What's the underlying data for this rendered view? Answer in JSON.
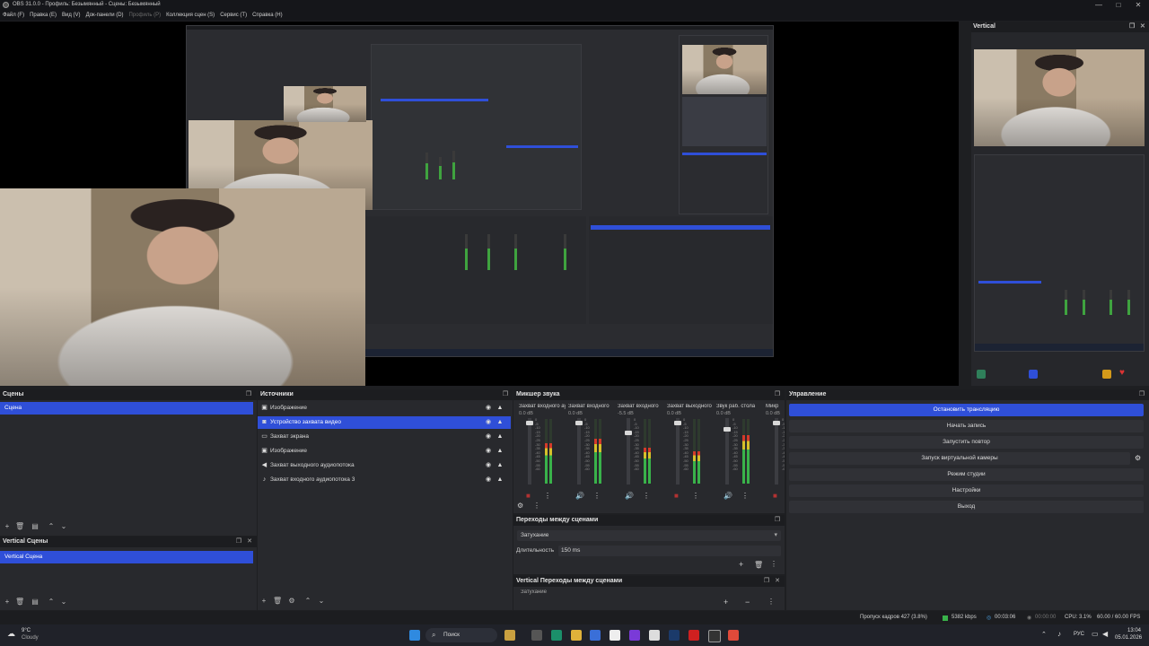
{
  "window": {
    "title": "OBS 31.0.0 - Профиль: Безымянный - Сцены: Безымянный",
    "controls": [
      "—",
      "□",
      "✕"
    ]
  },
  "menu": [
    {
      "label": "Файл (F)",
      "enabled": true
    },
    {
      "label": "Правка (E)",
      "enabled": true
    },
    {
      "label": "Вид (V)",
      "enabled": true
    },
    {
      "label": "Док-панели (D)",
      "enabled": true
    },
    {
      "label": "Профиль (P)",
      "enabled": false
    },
    {
      "label": "Коллекция сцен (S)",
      "enabled": true
    },
    {
      "label": "Сервис (T)",
      "enabled": true
    },
    {
      "label": "Справка (H)",
      "enabled": true
    }
  ],
  "vertical_preview": {
    "title": "Vertical"
  },
  "scenes": {
    "title": "Сцены",
    "items": [
      {
        "label": "Сцена",
        "selected": true
      }
    ]
  },
  "vertical_scenes": {
    "title": "Vertical Сцены",
    "items": [
      {
        "label": "Vertical Сцена",
        "selected": true
      }
    ]
  },
  "sources": {
    "title": "Источники",
    "items": [
      {
        "label": "Изображение",
        "icon": "image-icon",
        "selected": false
      },
      {
        "label": "Устройство захвата видео",
        "icon": "camera-icon",
        "selected": true
      },
      {
        "label": "Захват экрана",
        "icon": "monitor-icon",
        "selected": false
      },
      {
        "label": "Изображение",
        "icon": "image-icon",
        "selected": false
      },
      {
        "label": "Захват выходного аудиопотока",
        "icon": "speaker-icon",
        "selected": false
      },
      {
        "label": "Захват входного аудиопотока 3",
        "icon": "microphone-icon",
        "selected": false
      }
    ]
  },
  "mixer": {
    "title": "Микшер звука",
    "scale": [
      "0",
      "-5",
      "-10",
      "-15",
      "-20",
      "-25",
      "-30",
      "-35",
      "-40",
      "-45",
      "-50",
      "-55",
      "-60"
    ],
    "channels": [
      {
        "name": "Захват входного ауди",
        "db": "0.0 dB",
        "level": 0.62,
        "fader": 0.05,
        "muted": true
      },
      {
        "name": "Захват входного",
        "db": "0.0 dB",
        "level": 0.7,
        "fader": 0.05,
        "muted": false
      },
      {
        "name": "Захват входного",
        "db": "-5.5 dB",
        "level": 0.55,
        "fader": 0.2,
        "muted": false
      },
      {
        "name": "Захват выходного",
        "db": "0.0 dB",
        "level": 0.5,
        "fader": 0.05,
        "muted": true
      },
      {
        "name": "Звук раб. стола",
        "db": "0.0 dB",
        "level": 0.75,
        "fader": 0.15,
        "muted": false
      },
      {
        "name": "Микр",
        "db": "0.0 dB",
        "level": 0.0,
        "fader": 0.05,
        "muted": true
      }
    ]
  },
  "transitions": {
    "title": "Переходы между сценами",
    "selected": "Затухание",
    "duration_label": "Длительность",
    "duration_value": "150 ms"
  },
  "vertical_transitions": {
    "title": "Vertical Переходы между сценами",
    "selected": "Затухание"
  },
  "controls": {
    "title": "Управление",
    "buttons": [
      {
        "label": "Остановить трансляцию",
        "active": true
      },
      {
        "label": "Начать запись",
        "active": false
      },
      {
        "label": "Запустить повтор",
        "active": false
      },
      {
        "label": "Запуск виртуальной камеры",
        "active": false
      },
      {
        "label": "Режим студии",
        "active": false
      },
      {
        "label": "Настройки",
        "active": false
      },
      {
        "label": "Выход",
        "active": false
      }
    ]
  },
  "status": {
    "dropped": "Пропуск кадров 427 (3.8%)",
    "bitrate": "5382 kbps",
    "stream_time": "00:03:06",
    "rec_time": "00:00:00",
    "cpu": "CPU: 3.1%",
    "fps": "60.00 / 60.00 FPS"
  },
  "taskbar": {
    "weather_temp": "9°C",
    "weather_desc": "Cloudy",
    "search": "Поиск",
    "lang": "РУС",
    "time": "13:04",
    "date": "05.01.2026"
  },
  "colors": {
    "accent": "#2f4fd8",
    "panel": "#28292d",
    "header": "#1c1d20",
    "meter_green": "#39b24a",
    "muted": "#b33232"
  }
}
